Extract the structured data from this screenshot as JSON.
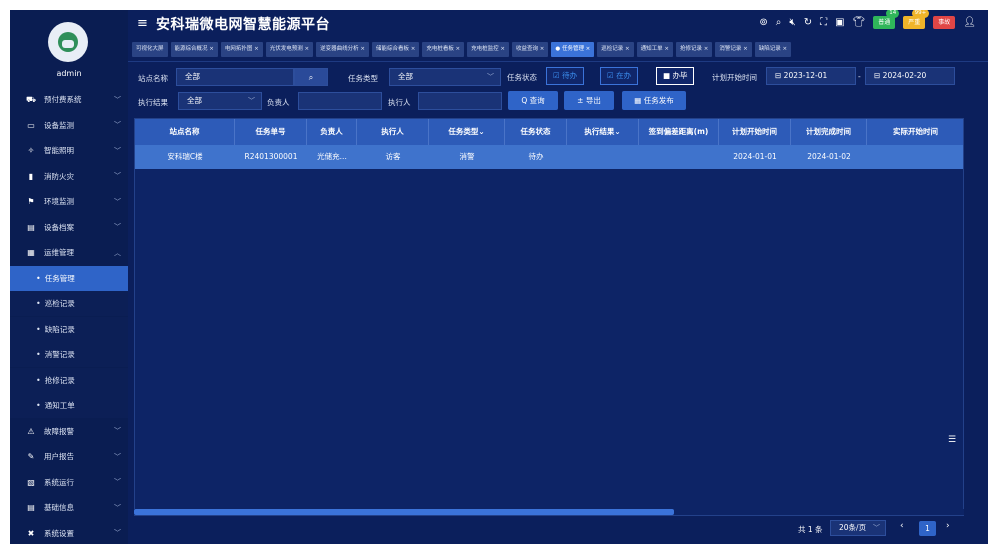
{
  "app": {
    "title": "安科瑞微电网智慧能源平台",
    "username": "admin"
  },
  "header": {
    "icons": [
      "lifebuoy-icon",
      "search-icon",
      "mute-icon",
      "refresh-icon",
      "fullscreen-icon",
      "screenshot-icon",
      "shirt-icon",
      "user-icon"
    ],
    "badges": [
      {
        "label": "普通",
        "count": "14",
        "color": "#2fb65a",
        "count_color": "#2fb65a"
      },
      {
        "label": "严重",
        "count": "99+",
        "color": "#f0b429",
        "count_color": "#f0b429"
      },
      {
        "label": "事故",
        "count": "",
        "color": "#e04646",
        "count_color": "#e04646"
      }
    ]
  },
  "tabs": [
    {
      "label": "可视化大屏",
      "closable": false,
      "active": false
    },
    {
      "label": "能源综合概况 ×",
      "active": false
    },
    {
      "label": "电网拓扑图 ×",
      "active": false
    },
    {
      "label": "光伏发电预测 ×",
      "active": false
    },
    {
      "label": "逆变器曲线分析 ×",
      "active": false
    },
    {
      "label": "储能综合看板 ×",
      "active": false
    },
    {
      "label": "充电桩看板 ×",
      "active": false
    },
    {
      "label": "充电桩监控 ×",
      "active": false
    },
    {
      "label": "收益查询 ×",
      "active": false
    },
    {
      "label": "● 任务管理 ×",
      "active": true
    },
    {
      "label": "巡检记录 ×",
      "active": false
    },
    {
      "label": "通知工单 ×",
      "active": false
    },
    {
      "label": "抢修记录 ×",
      "active": false
    },
    {
      "label": "消警记录 ×",
      "active": false
    },
    {
      "label": "缺陷记录 ×",
      "active": false
    }
  ],
  "sidebar": {
    "items": [
      {
        "label": "预付费系统",
        "icon": "prepaid-icon",
        "chevron": "﹀"
      },
      {
        "label": "设备监测",
        "icon": "monitor-icon",
        "chevron": "﹀"
      },
      {
        "label": "智能照明",
        "icon": "bulb-icon",
        "chevron": "﹀"
      },
      {
        "label": "消防火灾",
        "icon": "fire-extinguisher-icon",
        "chevron": "﹀"
      },
      {
        "label": "环境监测",
        "icon": "environment-icon",
        "chevron": "﹀"
      },
      {
        "label": "设备档案",
        "icon": "archive-icon",
        "chevron": "﹀"
      },
      {
        "label": "运维管理",
        "icon": "maintenance-icon",
        "chevron": "︿"
      }
    ],
    "sub_items": [
      {
        "label": "任务管理",
        "active": true
      },
      {
        "label": "巡检记录",
        "active": false
      },
      {
        "label": "缺陷记录",
        "active": false
      },
      {
        "label": "消警记录",
        "active": false
      },
      {
        "label": "抢修记录",
        "active": false
      },
      {
        "label": "通知工单",
        "active": false
      }
    ],
    "items_after": [
      {
        "label": "故障报警",
        "icon": "alarm-icon",
        "chevron": "﹀"
      },
      {
        "label": "用户报告",
        "icon": "report-icon",
        "chevron": "﹀"
      },
      {
        "label": "系统运行",
        "icon": "system-run-icon",
        "chevron": "﹀"
      },
      {
        "label": "基础信息",
        "icon": "info-icon",
        "chevron": "﹀"
      },
      {
        "label": "系统设置",
        "icon": "settings-tools-icon",
        "chevron": "﹀"
      }
    ]
  },
  "filters": {
    "station_label": "站点名称",
    "station_value": "全部",
    "task_type_label": "任务类型",
    "task_type_value": "全部",
    "task_status_label": "任务状态",
    "status_options": [
      {
        "label": "☑ 待办",
        "checked": true
      },
      {
        "label": "☑ 在办",
        "checked": true
      },
      {
        "label": "■ 办毕",
        "checked": false
      }
    ],
    "plan_start_label": "计划开始时间",
    "date_from": "2023-12-01",
    "date_sep": "-",
    "date_to": "2024-02-20",
    "result_label": "执行结果",
    "result_value": "全部",
    "owner_label": "负责人",
    "owner_value": "",
    "executor_label": "执行人",
    "executor_value": "",
    "query_button": "Q 查询",
    "export_button": "± 导出",
    "publish_button": "▦ 任务发布"
  },
  "table": {
    "columns": [
      "站点名称",
      "任务单号",
      "负责人",
      "执行人",
      "任务类型⌄",
      "任务状态",
      "执行结果⌄",
      "签到偏差距离(m)",
      "计划开始时间",
      "计划完成时间",
      "实际开始时间"
    ],
    "rows": [
      [
        "安科瑞C楼",
        "R2401300001",
        "光储充...",
        "访客",
        "消警",
        "待办",
        "",
        "",
        "2024-01-01",
        "2024-01-02",
        ""
      ]
    ]
  },
  "pagination": {
    "total": "共 1 条",
    "page_size": "20条/页",
    "current_page": "1",
    "prev": "‹",
    "next": "›"
  }
}
